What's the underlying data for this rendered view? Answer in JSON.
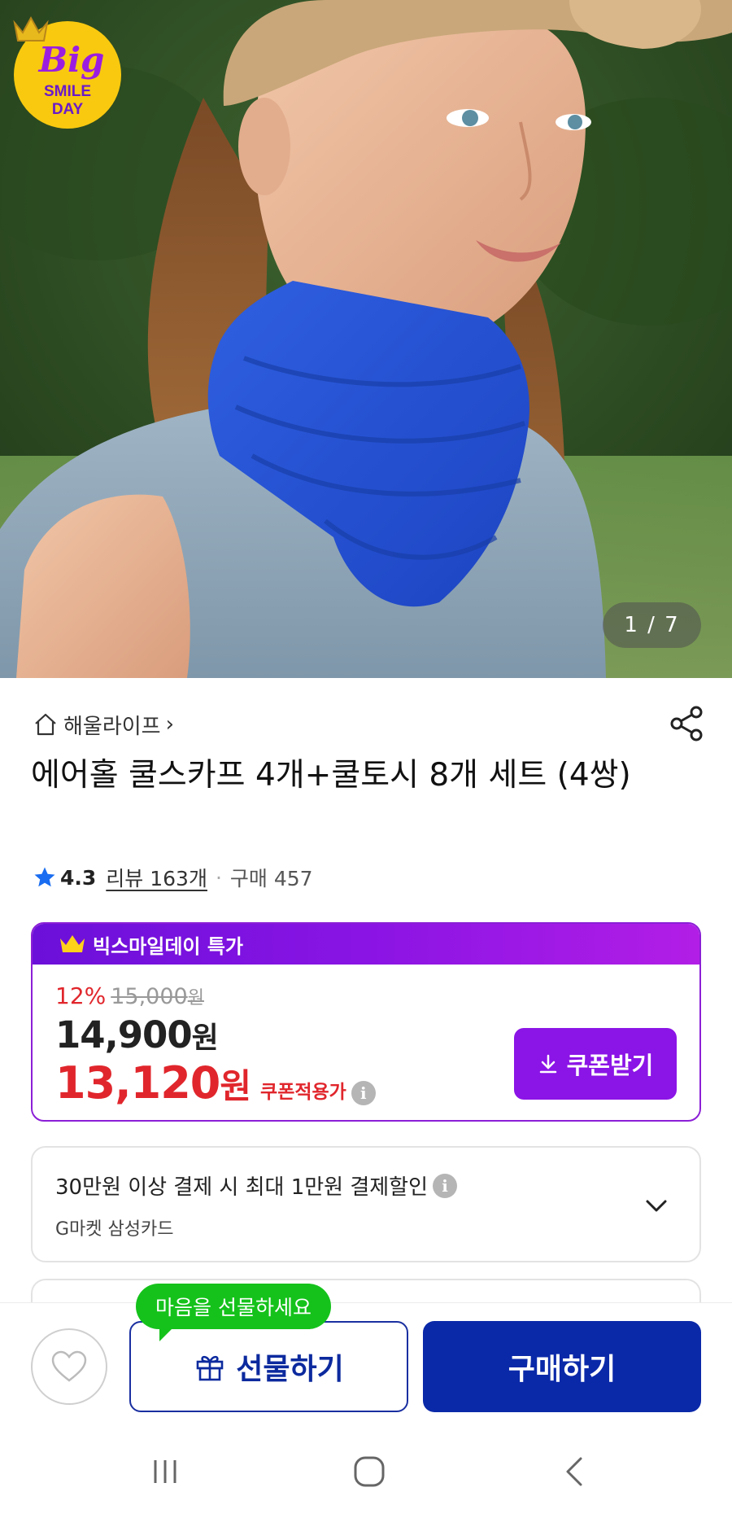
{
  "hero": {
    "image_alt": "Woman wearing a blue cool scarf around her neck",
    "counter": "1 / 7",
    "badge": {
      "big": "Big",
      "line1": "SMILE",
      "line2": "DAY"
    }
  },
  "store": {
    "name": "해울라이프"
  },
  "product": {
    "title": "에어홀 쿨스카프 4개+쿨토시 8개 세트 (4쌍)",
    "rating": "4.3",
    "reviews": "리뷰 163개",
    "purchases": "구매 457"
  },
  "deal": {
    "header": "빅스마일데이 특가",
    "discount_rate": "12%",
    "original_price": "15,000",
    "sale_price": "14,900",
    "coupon_price": "13,120",
    "won": "원",
    "coupon_label": "쿠폰적용가",
    "coupon_button": "쿠폰받기"
  },
  "card_benefit": {
    "title": "30만원 이상 결제 시 최대 1만원 결제할인",
    "sub": "G마켓 삼성카드"
  },
  "bottom": {
    "tooltip": "마음을 선물하세요",
    "gift_button": "선물하기",
    "buy_button": "구매하기"
  },
  "colors": {
    "deal_purple": "#8b14e6",
    "price_red": "#e0262c",
    "buy_blue": "#0a29a9",
    "tooltip_green": "#15c21b"
  },
  "icons": [
    "home-icon",
    "chevron-right-icon",
    "share-icon",
    "star-icon",
    "crown-icon",
    "info-icon",
    "download-icon",
    "chevron-down-icon",
    "heart-icon",
    "gift-icon",
    "recent-apps-icon",
    "home-circle-icon",
    "back-icon"
  ]
}
